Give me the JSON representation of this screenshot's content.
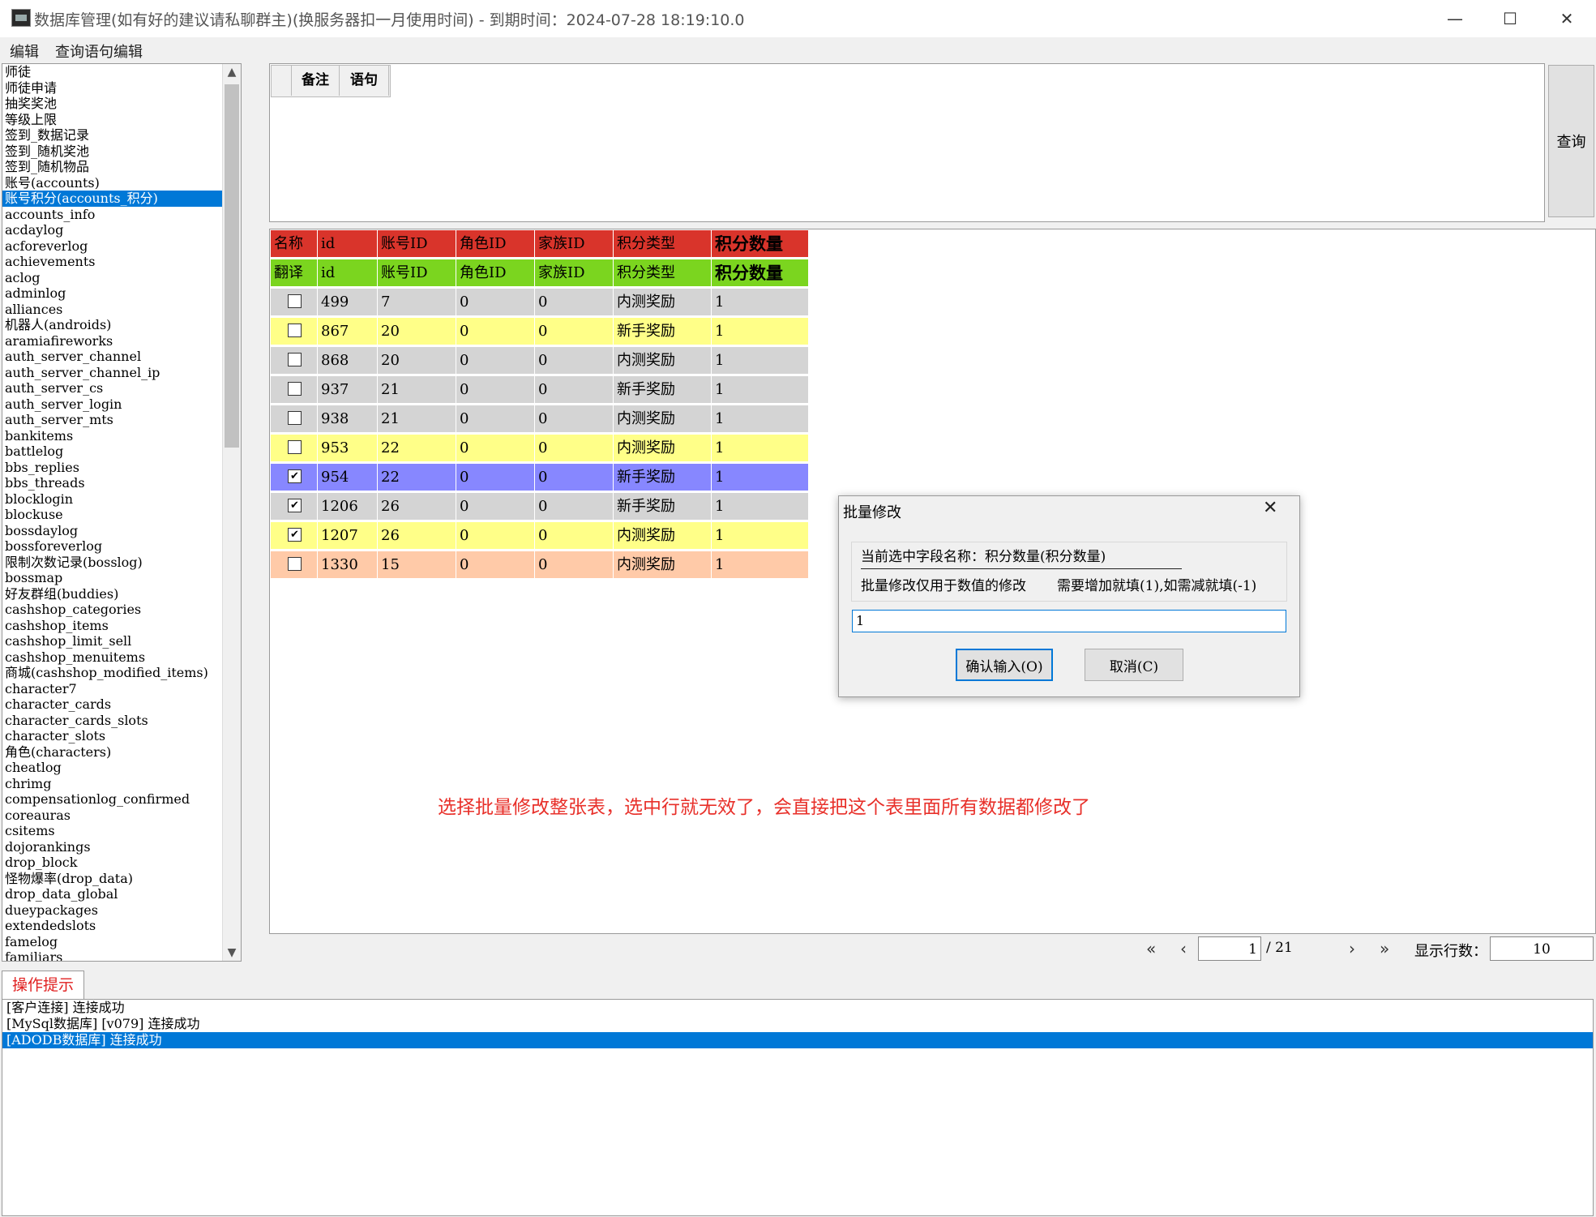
{
  "window": {
    "title": "数据库管理(如有好的建议请私聊群主)(换服务器扣一月使用时间) - 到期时间：2024-07-28 18:19:10.0",
    "minimize_glyph": "—",
    "maximize_glyph": "☐",
    "close_glyph": "✕"
  },
  "menu": {
    "items": [
      "编辑",
      "查询语句编辑"
    ]
  },
  "tables": [
    "师徒",
    "师徒申请",
    "抽奖奖池",
    "等级上限",
    "签到_数据记录",
    "签到_随机奖池",
    "签到_随机物品",
    "账号(accounts)",
    "账号积分(accounts_积分)",
    "accounts_info",
    "acdaylog",
    "acforeverlog",
    "achievements",
    "aclog",
    "adminlog",
    "alliances",
    "机器人(androids)",
    "aramiafireworks",
    "auth_server_channel",
    "auth_server_channel_ip",
    "auth_server_cs",
    "auth_server_login",
    "auth_server_mts",
    "bankitems",
    "battlelog",
    "bbs_replies",
    "bbs_threads",
    "blocklogin",
    "blockuse",
    "bossdaylog",
    "bossforeverlog",
    "限制次数记录(bosslog)",
    "bossmap",
    "好友群组(buddies)",
    "cashshop_categories",
    "cashshop_items",
    "cashshop_limit_sell",
    "cashshop_menuitems",
    "商城(cashshop_modified_items)",
    "character7",
    "character_cards",
    "character_cards_slots",
    "character_slots",
    "角色(characters)",
    "cheatlog",
    "chrimg",
    "compensationlog_confirmed",
    "coreauras",
    "csitems",
    "dojorankings",
    "drop_block",
    "怪物爆率(drop_data)",
    "drop_data_global",
    "dueypackages",
    "extendedslots",
    "famelog",
    "familiars"
  ],
  "selected_table": "账号积分(accounts_积分)",
  "sql_tabs": [
    "备注",
    "语句"
  ],
  "query_button": "查询",
  "grid": {
    "header_row": [
      "名称",
      "id",
      "账号ID",
      "角色ID",
      "家族ID",
      "积分类型",
      "积分数量"
    ],
    "translate_row": [
      "翻译",
      "id",
      "账号ID",
      "角色ID",
      "家族ID",
      "积分类型",
      "积分数量"
    ],
    "rows": [
      {
        "checked": false,
        "cells": [
          "499",
          "7",
          "0",
          "0",
          "内测奖励",
          "1"
        ],
        "color": "#d4d4d4"
      },
      {
        "checked": false,
        "cells": [
          "867",
          "20",
          "0",
          "0",
          "新手奖励",
          "1"
        ],
        "color": "#ffff88"
      },
      {
        "checked": false,
        "cells": [
          "868",
          "20",
          "0",
          "0",
          "内测奖励",
          "1"
        ],
        "color": "#d4d4d4"
      },
      {
        "checked": false,
        "cells": [
          "937",
          "21",
          "0",
          "0",
          "新手奖励",
          "1"
        ],
        "color": "#d4d4d4"
      },
      {
        "checked": false,
        "cells": [
          "938",
          "21",
          "0",
          "0",
          "内测奖励",
          "1"
        ],
        "color": "#d4d4d4"
      },
      {
        "checked": false,
        "cells": [
          "953",
          "22",
          "0",
          "0",
          "内测奖励",
          "1"
        ],
        "color": "#ffff88"
      },
      {
        "checked": true,
        "cells": [
          "954",
          "22",
          "0",
          "0",
          "新手奖励",
          "1"
        ],
        "color": "#8787ff"
      },
      {
        "checked": true,
        "cells": [
          "1206",
          "26",
          "0",
          "0",
          "新手奖励",
          "1"
        ],
        "color": "#d4d4d4"
      },
      {
        "checked": true,
        "cells": [
          "1207",
          "26",
          "0",
          "0",
          "内测奖励",
          "1"
        ],
        "color": "#ffff88"
      },
      {
        "checked": false,
        "cells": [
          "1330",
          "15",
          "0",
          "0",
          "内测奖励",
          "1"
        ],
        "color": "#ffcaa8"
      }
    ]
  },
  "hint_text": "选择批量修改整张表，选中行就无效了，会直接把这个表里面所有数据都修改了",
  "pager": {
    "first": "«",
    "prev": "‹",
    "next": "›",
    "last": "»",
    "page": "1",
    "total": "/ 21",
    "rows_label": "显示行数：",
    "rows_value": "10"
  },
  "log": {
    "tab": "操作提示",
    "lines": [
      "[客户连接] 连接成功",
      "[MySql数据库] [v079] 连接成功",
      "[ADODB数据库] 连接成功"
    ]
  },
  "dialog": {
    "title": "批量修改",
    "close_glyph": "✕",
    "field": "当前选中字段名称：积分数量(积分数量)",
    "note1": "批量修改仅用于数值的修改",
    "note2": "需要增加就填(1),如需减就填(-1)",
    "input_value": "1",
    "ok": "确认输入(O)",
    "cancel": "取消(C)"
  }
}
